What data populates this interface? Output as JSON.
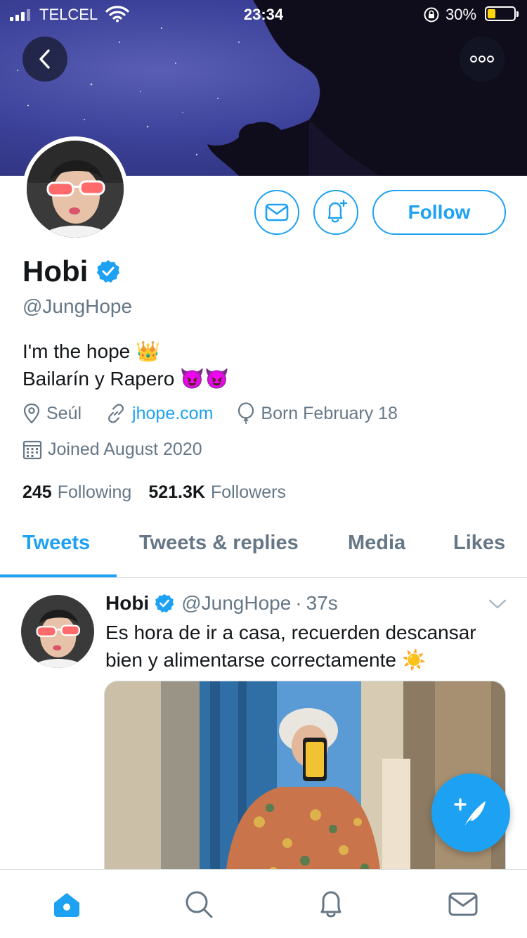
{
  "status_bar": {
    "carrier": "TELCEL",
    "time": "23:34",
    "battery_percent_text": "30%",
    "battery_level": 0.3,
    "battery_color": "#ffd60a"
  },
  "header": {
    "back_icon": "chevron-left-icon",
    "more_icon": "more-horizontal-icon"
  },
  "profile": {
    "display_name": "Hobi",
    "verified": true,
    "handle": "@JungHope",
    "bio_line1": "I'm the hope",
    "bio_line1_emoji": "👑",
    "bio_line2": "Bailarín y Rapero",
    "bio_line2_emoji": "😈😈",
    "location": "Seúl",
    "website": "jhope.com",
    "birthday": "Born February 18",
    "joined": "Joined August 2020",
    "following_count": "245",
    "following_label": "Following",
    "followers_count": "521.3K",
    "followers_label": "Followers",
    "follow_label": "Follow"
  },
  "tabs": [
    {
      "label": "Tweets",
      "active": true
    },
    {
      "label": "Tweets & replies",
      "active": false
    },
    {
      "label": "Media",
      "active": false
    },
    {
      "label": "Likes",
      "active": false
    }
  ],
  "tweet": {
    "name": "Hobi",
    "handle": "@JungHope",
    "separator": "·",
    "time": "37s",
    "text": "Es hora de ir a casa, recuerden descansar bien y alimentarse correctamente",
    "text_emoji": "☀️"
  },
  "bottom_nav": [
    {
      "icon": "home-icon",
      "active": true
    },
    {
      "icon": "search-icon",
      "active": false
    },
    {
      "icon": "bell-icon",
      "active": false
    },
    {
      "icon": "mail-icon",
      "active": false
    }
  ],
  "colors": {
    "accent": "#1da1f2",
    "text_primary": "#14171a",
    "text_secondary": "#657786"
  }
}
